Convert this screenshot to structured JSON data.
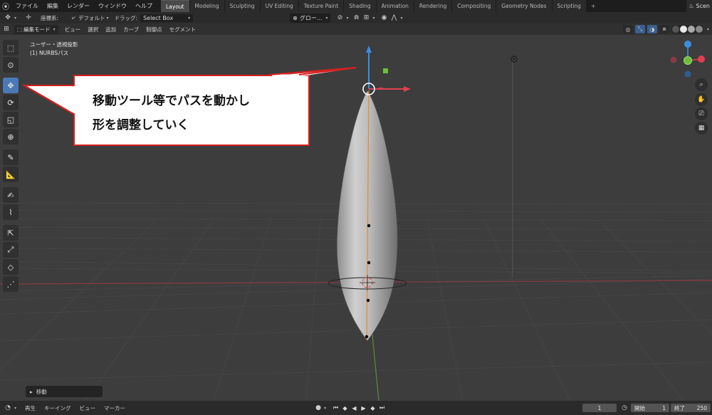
{
  "topbar": {
    "menus": [
      "ファイル",
      "編集",
      "レンダー",
      "ウィンドウ",
      "ヘルプ"
    ],
    "tabs": [
      "Layout",
      "Modeling",
      "Sculpting",
      "UV Editing",
      "Texture Paint",
      "Shading",
      "Animation",
      "Rendering",
      "Compositing",
      "Geometry Nodes",
      "Scripting"
    ],
    "add_tab": "+",
    "scene_label": "Scen"
  },
  "tool_settings": {
    "orientation_label": "座標系:",
    "orientation_value": "デフォルト",
    "drag_label": "ドラッグ:",
    "drag_value": "Select Box",
    "transform_pivot": "グロー...",
    "snap_icon": "magnet-icon"
  },
  "header": {
    "mode": "編集モード",
    "menus": [
      "ビュー",
      "選択",
      "追加",
      "カーブ",
      "制御点",
      "セグメント"
    ]
  },
  "viewport": {
    "view_name": "ユーザー・透視投影",
    "object_name": "(1) NURBSパス"
  },
  "callout": {
    "line1": "移動ツール等でパスを動かし",
    "line2": "形を調整していく"
  },
  "operator_panel": {
    "label": "移動"
  },
  "timeline": {
    "menus": [
      "再生",
      "キーイング",
      "ビュー",
      "マーカー"
    ],
    "current_frame": "1",
    "start_label": "開始",
    "start_value": "1",
    "end_label": "終了",
    "end_value": "250"
  },
  "colors": {
    "accent": "#4b79b6",
    "callout_border": "#d42020",
    "x_axis": "#e04040",
    "y_axis": "#7ab83a",
    "z_axis": "#3a8ee0"
  }
}
